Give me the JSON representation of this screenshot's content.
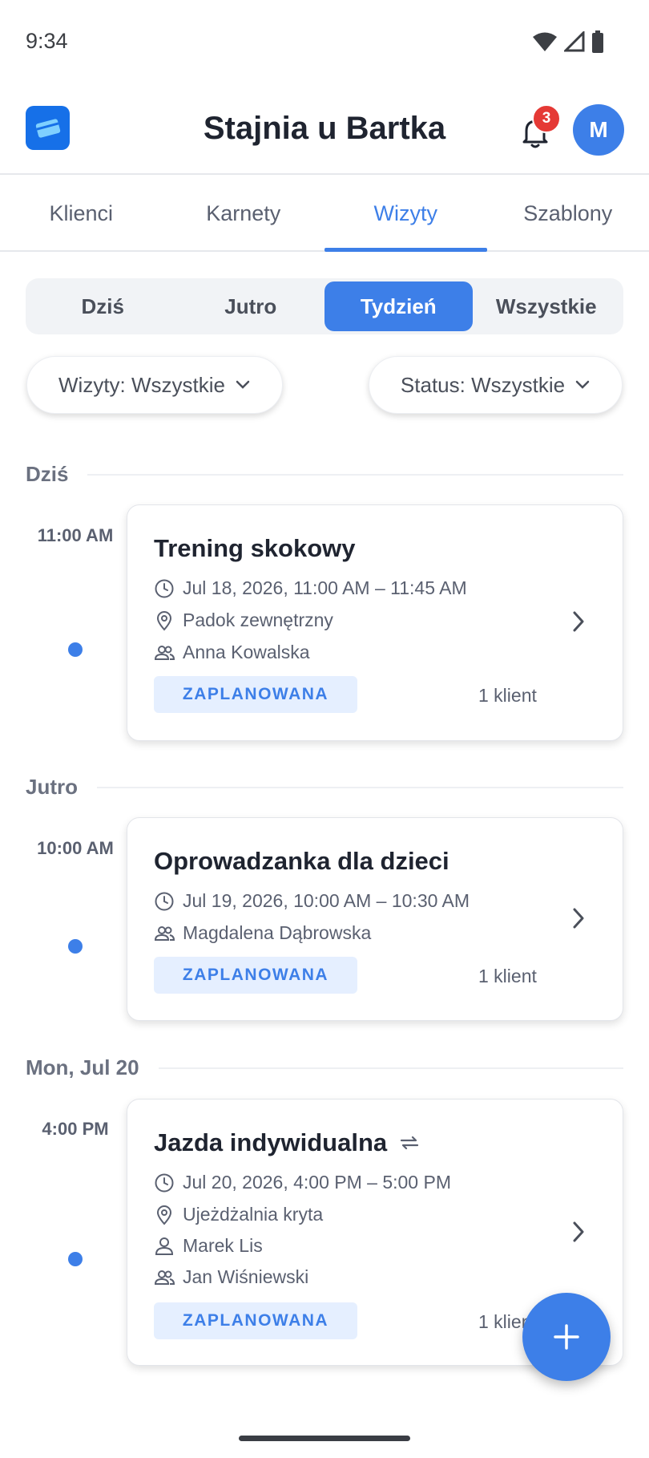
{
  "status_bar": {
    "time": "9:34"
  },
  "app_bar": {
    "title": "Stajnia u Bartka",
    "notification_count": "3",
    "avatar_initial": "M"
  },
  "tabs": [
    {
      "label": "Klienci"
    },
    {
      "label": "Karnety"
    },
    {
      "label": "Wizyty",
      "active": true
    },
    {
      "label": "Szablony"
    }
  ],
  "period": [
    {
      "label": "Dziś"
    },
    {
      "label": "Jutro"
    },
    {
      "label": "Tydzień",
      "active": true
    },
    {
      "label": "Wszystkie"
    }
  ],
  "filters": {
    "visits": "Wizyty: Wszystkie",
    "status": "Status: Wszystkie"
  },
  "sections": [
    {
      "label": "Dziś",
      "visits": [
        {
          "time": "11:00 AM",
          "title": "Trening skokowy",
          "datetime": "Jul 18, 2026, 11:00 AM – 11:45 AM",
          "location": "Padok zewnętrzny",
          "clients": "Anna Kowalska",
          "status": "ZAPLANOWANA",
          "client_count": "1 klient"
        }
      ]
    },
    {
      "label": "Jutro",
      "visits": [
        {
          "time": "10:00 AM",
          "title": "Oprowadzanka dla dzieci",
          "datetime": "Jul 19, 2026, 10:00 AM – 10:30 AM",
          "clients": "Magdalena Dąbrowska",
          "status": "ZAPLANOWANA",
          "client_count": "1 klient"
        }
      ]
    },
    {
      "label": "Mon, Jul 20",
      "visits": [
        {
          "time": "4:00 PM",
          "title": "Jazda indywidualna",
          "recurring": true,
          "datetime": "Jul 20, 2026, 4:00 PM – 5:00 PM",
          "location": "Ujeżdżalnia kryta",
          "instructor": "Marek Lis",
          "clients": "Jan Wiśniewski",
          "status": "ZAPLANOWANA",
          "client_count": "1 klient"
        }
      ]
    }
  ],
  "colors": {
    "accent": "#3d7fe8",
    "badge_bg": "#e5efff",
    "notification": "#e53935",
    "logo": "#1670e8"
  },
  "icons": [
    "wifi-icon",
    "signal-icon",
    "battery-icon",
    "app-logo-icon",
    "bell-icon",
    "chevron-down-icon",
    "clock-icon",
    "location-pin-icon",
    "person-icon",
    "people-icon",
    "repeat-icon",
    "chevron-right-icon",
    "plus-icon"
  ]
}
